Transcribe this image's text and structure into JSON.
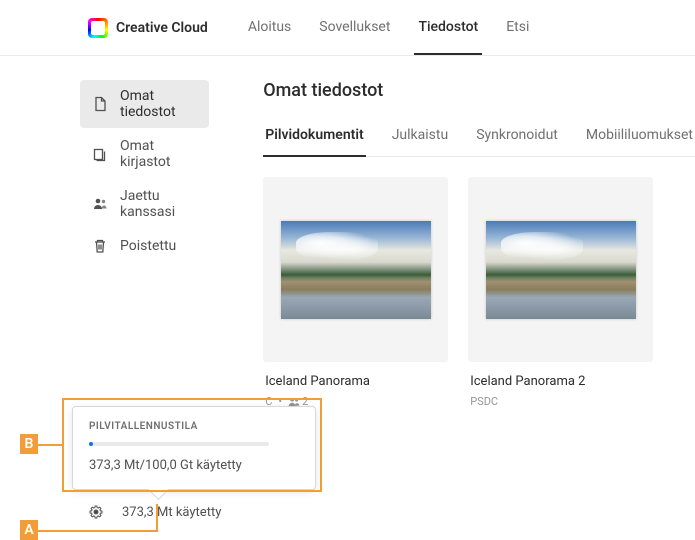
{
  "header": {
    "brand": "Creative Cloud",
    "nav": [
      {
        "label": "Aloitus",
        "active": false
      },
      {
        "label": "Sovellukset",
        "active": false
      },
      {
        "label": "Tiedostot",
        "active": true
      },
      {
        "label": "Etsi",
        "active": false
      }
    ]
  },
  "sidebar": {
    "items": [
      {
        "label": "Omat tiedostot",
        "selected": true
      },
      {
        "label": "Omat kirjastot",
        "selected": false
      },
      {
        "label": "Jaettu kanssasi",
        "selected": false
      },
      {
        "label": "Poistettu",
        "selected": false
      }
    ]
  },
  "page": {
    "title": "Omat tiedostot"
  },
  "tabs": [
    {
      "label": "Pilvidokumentit",
      "active": true
    },
    {
      "label": "Julkaistu",
      "active": false
    },
    {
      "label": "Synkronoidut",
      "active": false
    },
    {
      "label": "Mobiililuomukset",
      "active": false
    }
  ],
  "files": [
    {
      "name": "Iceland Panorama",
      "type_suffix": "C",
      "shared_count": "2"
    },
    {
      "name": "Iceland Panorama 2",
      "type": "PSDC"
    }
  ],
  "storage_popup": {
    "title": "PILVITALLENNUSTILA",
    "text": "373,3 Mt/100,0 Gt käytetty"
  },
  "storage_line": {
    "text": "373,3 Mt käytetty"
  },
  "callouts": {
    "a": "A",
    "b": "B"
  }
}
